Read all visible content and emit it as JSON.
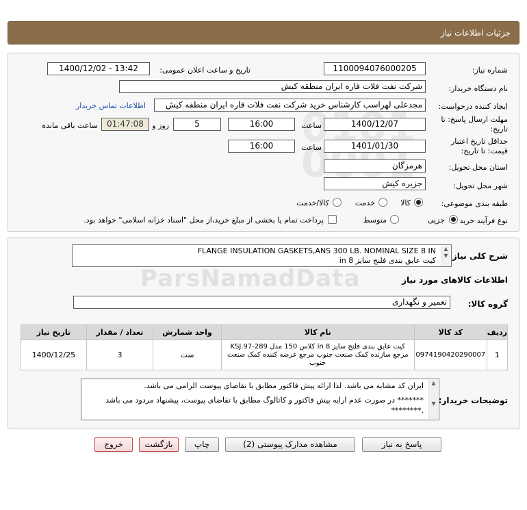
{
  "header": {
    "title": "جزئیات اطلاعات نیاز"
  },
  "form": {
    "need_number_label": "شماره نیاز:",
    "need_number": "1100094076000205",
    "announce_label": "تاریخ و ساعت اعلان عمومی:",
    "announce_value": "1400/12/02 - 13:42",
    "buyer_org_label": "نام دستگاه خریدار:",
    "buyer_org": "شرکت نفت فلات قاره ایران منطقه کیش",
    "requester_label": "ایجاد کننده درخواست:",
    "requester": "مجدعلی لهراسب کارشناس خرید شرکت نفت فلات قاره ایران منطقه کیش",
    "contact_link": "اطلاعات تماس خریدار",
    "reply_deadline_label": "مهلت ارسال پاسخ: تا تاریخ:",
    "reply_date": "1400/12/07",
    "time_label": "ساعت",
    "reply_time": "16:00",
    "days_value": "5",
    "days_label": "روز و",
    "remaining_time": "01:47:08",
    "remaining_label": "ساعت باقی مانده",
    "price_validity_label": "حداقل تاریخ اعتبار قیمت: تا تاریخ:",
    "validity_date": "1401/01/30",
    "validity_time_label": "ساعت",
    "validity_time": "16:00",
    "province_label": "استان محل تحویل:",
    "province": "هرمزگان",
    "city_label": "شهر محل تحویل:",
    "city": "جزیره کیش",
    "category_label": "طبقه بندی موضوعی:",
    "category_options": [
      "کالا",
      "خدمت",
      "کالا/خدمت"
    ],
    "purchase_type_label": "نوع فرآیند خرید :",
    "purchase_options": [
      "جزیی",
      "متوسط"
    ],
    "payment_note": "پرداخت تمام یا بخشی از مبلغ خرید،از محل \"اسناد خزانه اسلامی\" خواهد بود."
  },
  "description": {
    "label": "شرح کلی نیاز:",
    "line1": "FLANGE INSULATION GASKETS,ANS 300 LB. NOMINAL SIZE 8 IN",
    "line2": "کیت عایق بندی فلنج سایز 8 in"
  },
  "goods_section": {
    "title": "اطلاعات کالاهای مورد نیاز",
    "group_label": "گروه کالا:",
    "group_value": "تعمیر و نگهداری"
  },
  "table": {
    "headers": [
      "ردیف",
      "کد کالا",
      "نام کالا",
      "واحد شمارش",
      "تعداد / مقدار",
      "تاریخ نیاز"
    ],
    "rows": [
      {
        "row": "1",
        "code": "0974190420290007",
        "name": "کیت عایق بندی فلنج سایز 8 in کلاس 150 مدل KSJ.97-289 مرجع سازنده کمک صنعت جنوب مرجع عرضه کننده کمک صنعت جنوب",
        "unit": "ست",
        "qty": "3",
        "date": "1400/12/25"
      }
    ]
  },
  "notes": {
    "label": "توضیحات خریدار:",
    "line1": "ایران کد مشابه می باشد. لذا ارائه پیش فاکتور مطابق با تقاضای پیوست الزامی می باشد.",
    "line2": "******* در صورت عدم ارایه پیش فاکتور و کاتالوگ مطابق با تقاضای پیوست، پیشنهاد مردود می باشد .********"
  },
  "buttons": {
    "reply": "پاسخ به نیاز",
    "attachments": "مشاهده مدارک پیوستی (2)",
    "print": "چاپ",
    "back": "بازگشت",
    "exit": "خروج"
  },
  "colors": {
    "header_bg": "#8b6d4a",
    "link": "#1a4ba8",
    "table_header": "#d9d9d9"
  }
}
